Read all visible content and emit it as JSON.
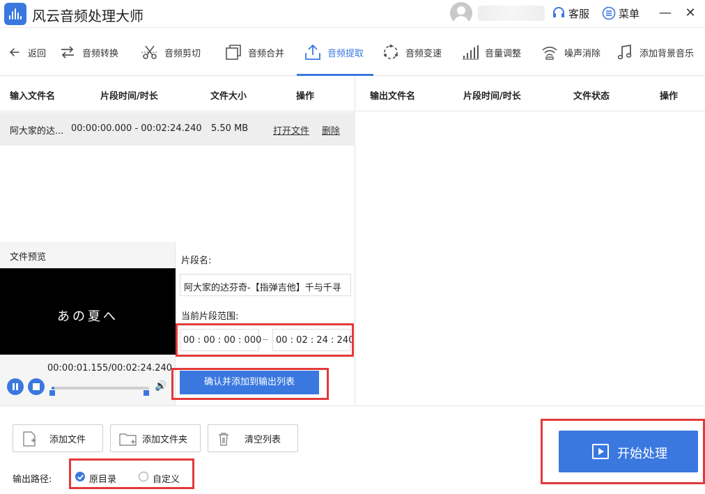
{
  "app": {
    "title": "风云音频处理大师",
    "support": "客服",
    "menu": "菜单"
  },
  "toolbar": {
    "back": "返回",
    "items": [
      "音频转换",
      "音频剪切",
      "音频合并",
      "音频提取",
      "音频变速",
      "音量调整",
      "噪声消除",
      "添加背景音乐"
    ],
    "active": "音频提取"
  },
  "input_table": {
    "headers": [
      "输入文件名",
      "片段时间/时长",
      "文件大小",
      "操作"
    ],
    "rows": [
      {
        "name": "阿大家的达...",
        "range": "00:00:00.000 - 00:02:24.240",
        "size": "5.50 MB",
        "open": "打开文件",
        "delete": "删除"
      }
    ]
  },
  "output_table": {
    "headers": [
      "输出文件名",
      "片段时间/时长",
      "文件状态",
      "操作"
    ]
  },
  "preview": {
    "label": "文件预览",
    "video_text": "あの夏へ",
    "time": "00:00:01.155/00:02:24.240",
    "progress": 0.008
  },
  "segment": {
    "name_label": "片段名:",
    "name_value": "阿大家的达芬奇-【指弹吉他】千与千寻",
    "range_label": "当前片段范围:",
    "start": "00 : 00 : 00 : 000",
    "end": "00 : 02 : 24 : 240",
    "confirm": "确认并添加到输出列表"
  },
  "bottom": {
    "add_file": "添加文件",
    "add_folder": "添加文件夹",
    "clear": "清空列表",
    "output_path_label": "输出路径:",
    "opt_original": "原目录",
    "opt_custom": "自定义",
    "start": "开始处理"
  },
  "colors": {
    "accent": "#3a78e0",
    "highlight": "#e33a3a"
  }
}
